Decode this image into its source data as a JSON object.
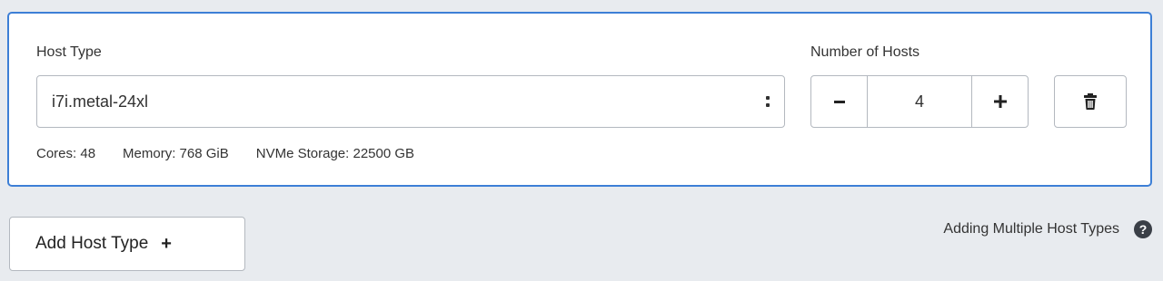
{
  "host_config": {
    "host_type_label": "Host Type",
    "host_type_value": "i7i.metal-24xl",
    "number_of_hosts_label": "Number of Hosts",
    "number_of_hosts_value": "4",
    "minus_icon": "minus-icon",
    "plus_icon": "plus-icon",
    "delete_icon": "trash-icon",
    "specs": {
      "cores": "Cores: 48",
      "memory": "Memory: 768 GiB",
      "storage": "NVMe Storage: 22500 GB"
    }
  },
  "add_host_type": {
    "label": "Add Host Type",
    "plus_sign": "+"
  },
  "help": {
    "label": "Adding Multiple Host Types",
    "icon": "question-circle-icon",
    "icon_glyph": "?"
  },
  "colors": {
    "accent_border": "#3d7fd6",
    "page_background": "#e8ebef"
  }
}
